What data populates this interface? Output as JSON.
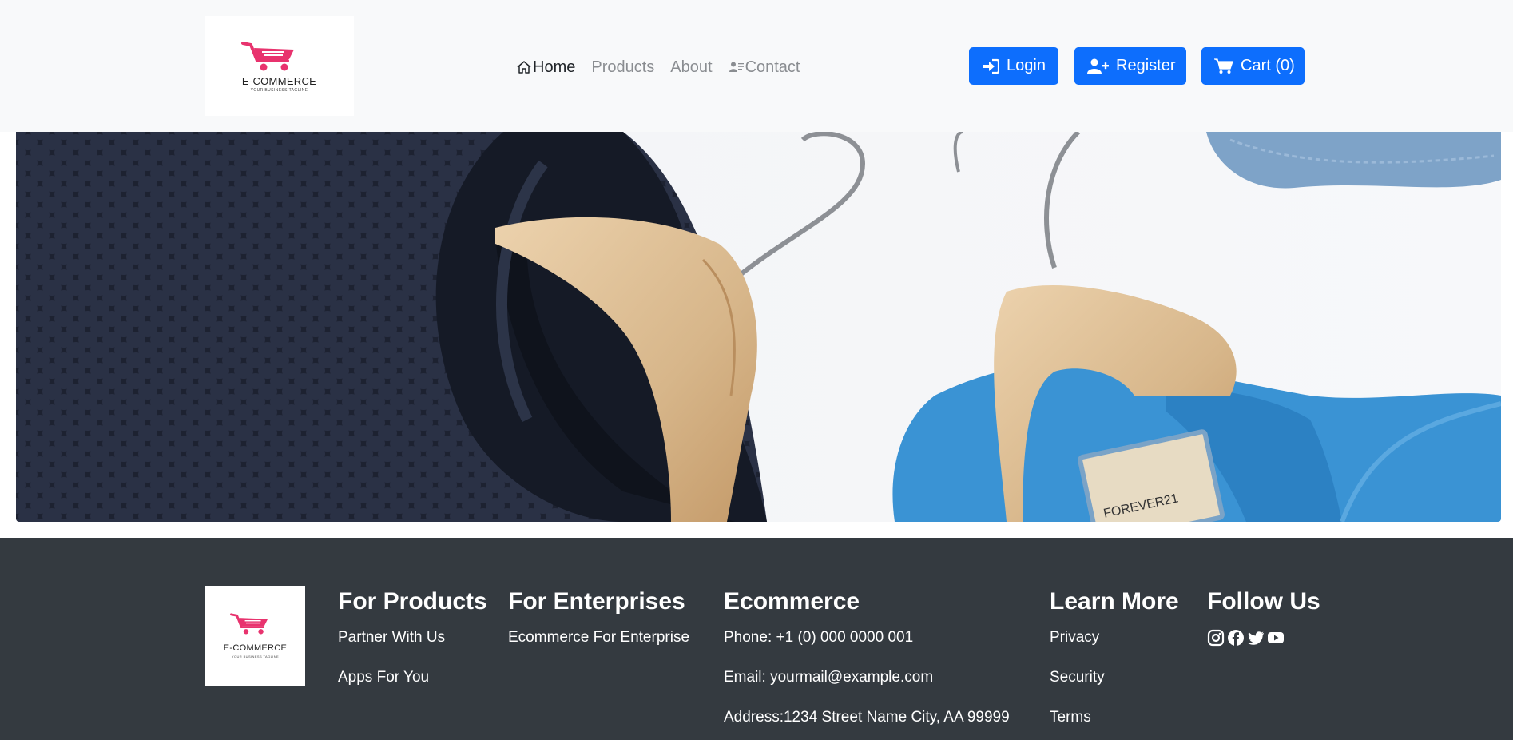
{
  "logo": {
    "title": "E-COMMERCE",
    "tagline": "YOUR BUSINESS TAGLINE",
    "cart_color": "#e8336e"
  },
  "nav": {
    "items": [
      {
        "label": "Home",
        "icon": "home-icon",
        "active": true
      },
      {
        "label": "Products",
        "active": false
      },
      {
        "label": "About",
        "active": false
      },
      {
        "label": "Contact",
        "icon": "contact-card-icon",
        "active": false
      }
    ]
  },
  "actions": {
    "login": "Login",
    "register": "Register",
    "cart": "Cart (0)"
  },
  "hero": {
    "subject": "clothes-on-hangers-banner",
    "tag_text": "FOREVER21"
  },
  "footer": {
    "products": {
      "heading": "For Products",
      "links": [
        "Partner With Us",
        "Apps For You"
      ]
    },
    "enterprises": {
      "heading": "For Enterprises",
      "links": [
        "Ecommerce For Enterprise"
      ]
    },
    "ecommerce": {
      "heading": "Ecommerce",
      "phone": "Phone: +1 (0) 000 0000 001",
      "email": "Email: yourmail@example.com",
      "address": "Address:1234 Street Name City, AA 99999"
    },
    "learn": {
      "heading": "Learn More",
      "links": [
        "Privacy",
        "Security",
        "Terms"
      ]
    },
    "follow": {
      "heading": "Follow Us",
      "icons": [
        "instagram-icon",
        "facebook-icon",
        "twitter-icon",
        "youtube-icon"
      ]
    }
  },
  "colors": {
    "primary": "#0d6efd",
    "header_bg": "#f8f9fa",
    "footer_bg": "#343a40"
  }
}
